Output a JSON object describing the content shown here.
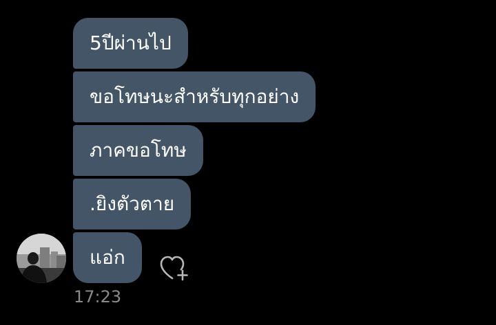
{
  "messages": [
    {
      "text": "5ปีผ่านไป"
    },
    {
      "text": "ขอโทษนะสำหรับทุกอย่าง"
    },
    {
      "text": "ภาคขอโทษ"
    },
    {
      "text": ".ยิงตัวตาย"
    },
    {
      "text": "แอ่ก"
    }
  ],
  "timestamp": "17:23",
  "icons": {
    "avatar": "profile-photo",
    "reaction": "heart-add-icon"
  },
  "colors": {
    "background": "#000000",
    "bubble": "#435566",
    "bubble_text": "#ffffff",
    "timestamp": "#8a8a8a"
  }
}
